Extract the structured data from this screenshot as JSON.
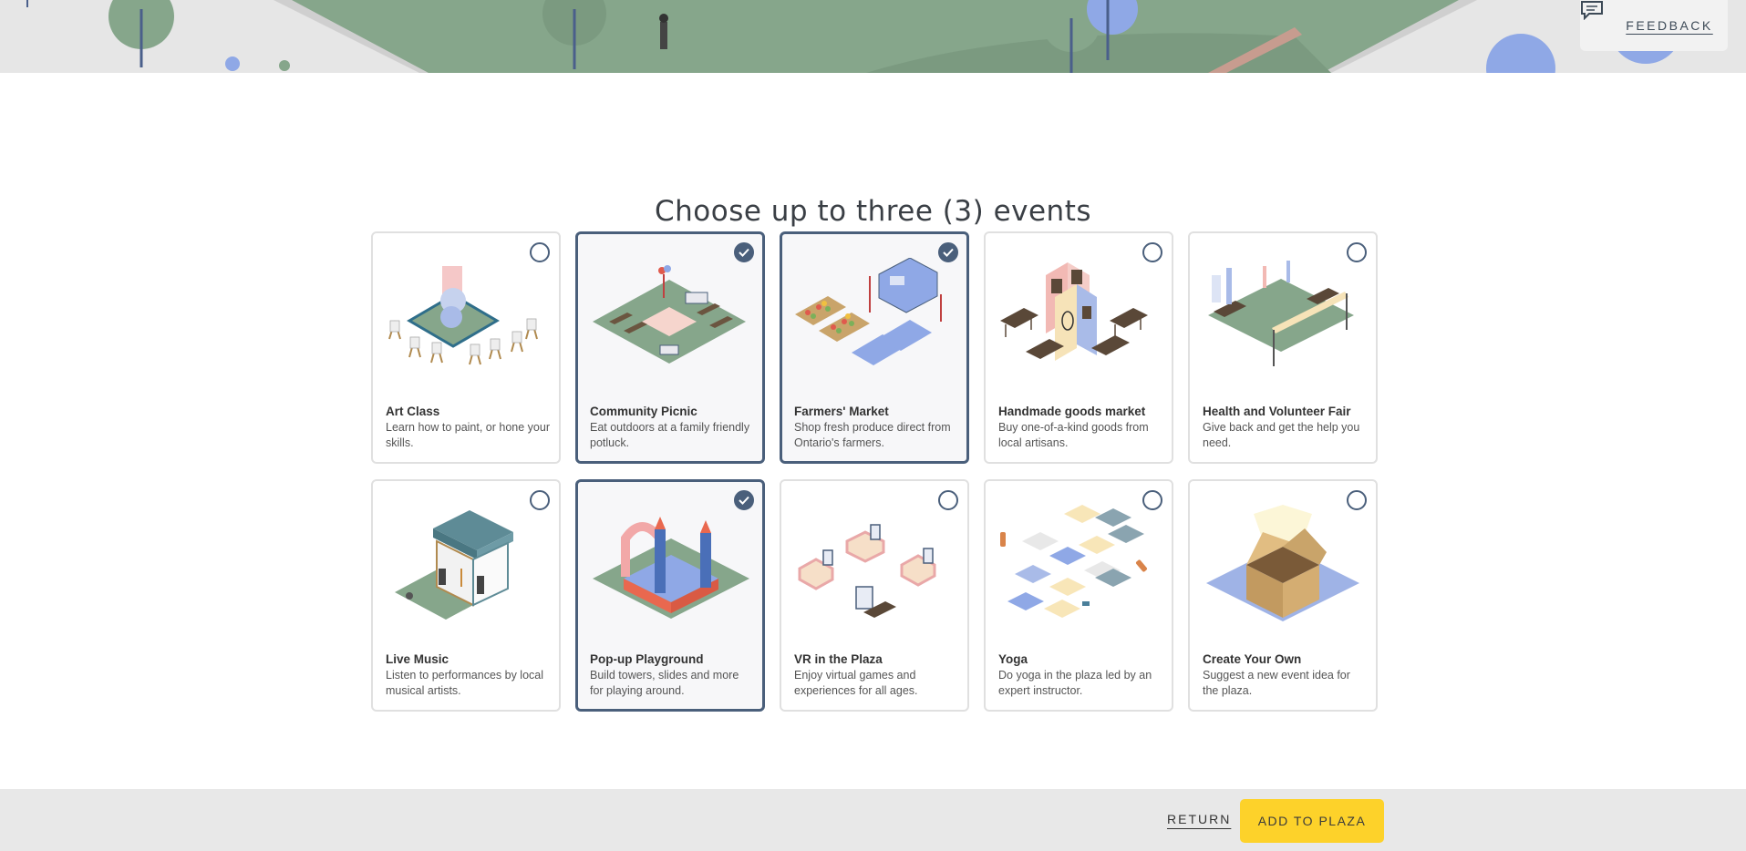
{
  "header": {
    "feedback_label": "FEEDBACK",
    "feedback_icon": "chat-bubble-icon"
  },
  "main": {
    "title": "Choose up to three (3) events",
    "events": [
      {
        "name": "Art Class",
        "description": "Learn how to paint, or hone your skills.",
        "selected": false,
        "icon": "art-class-illustration"
      },
      {
        "name": "Community Picnic",
        "description": "Eat outdoors at a family friendly potluck.",
        "selected": true,
        "icon": "community-picnic-illustration"
      },
      {
        "name": "Farmers' Market",
        "description": "Shop fresh produce direct from Ontario's farmers.",
        "selected": true,
        "icon": "farmers-market-illustration"
      },
      {
        "name": "Handmade goods market",
        "description": "Buy one-of-a-kind goods from local artisans.",
        "selected": false,
        "icon": "handmade-goods-illustration"
      },
      {
        "name": "Health and Volunteer Fair",
        "description": "Give back and get the help you need.",
        "selected": false,
        "icon": "health-fair-illustration"
      },
      {
        "name": "Live Music",
        "description": "Listen to performances by local musical artists.",
        "selected": false,
        "icon": "live-music-illustration"
      },
      {
        "name": "Pop-up Playground",
        "description": "Build towers, slides and more for playing around.",
        "selected": true,
        "icon": "playground-illustration"
      },
      {
        "name": "VR in the Plaza",
        "description": "Enjoy virtual games and experiences for all ages.",
        "selected": false,
        "icon": "vr-illustration"
      },
      {
        "name": "Yoga",
        "description": "Do yoga in the plaza led by an expert instructor.",
        "selected": false,
        "icon": "yoga-illustration"
      },
      {
        "name": "Create Your Own",
        "description": "Suggest a new event idea for the plaza.",
        "selected": false,
        "icon": "open-box-illustration"
      }
    ]
  },
  "footer": {
    "return_label": "RETURN",
    "add_label": "ADD TO PLAZA"
  },
  "colors": {
    "accent": "#4a5f7b",
    "button_yellow": "#fdd22a",
    "banner_green": "#86a68b",
    "footer_gray": "#e8e8e8"
  }
}
